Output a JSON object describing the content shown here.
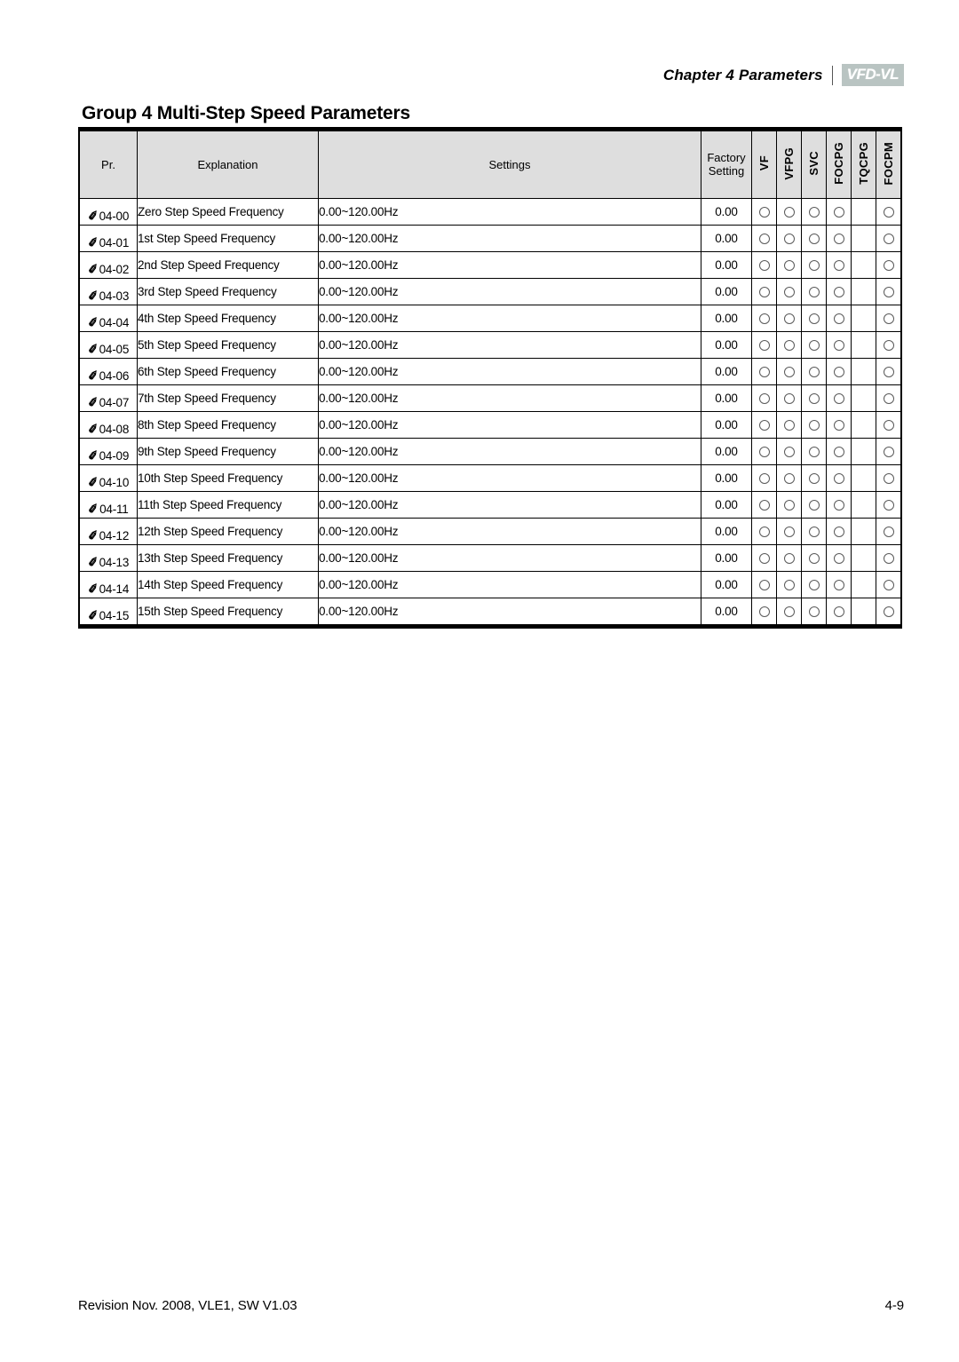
{
  "header": {
    "chapter": "Chapter 4 Parameters",
    "brand": "VFD-VL",
    "divider_icon": "vertical-bar-icon"
  },
  "title": "Group 4 Multi-Step Speed Parameters",
  "table": {
    "columns": {
      "pr": "Pr.",
      "explanation": "Explanation",
      "settings": "Settings",
      "factory_setting": "Factory Setting",
      "factory_setting_line1": "Factory",
      "factory_setting_line2": "Setting",
      "modes": [
        "VF",
        "VFPG",
        "SVC",
        "FOCPG",
        "TQCPG",
        "FOCPM"
      ]
    },
    "marker_icon": "pencil-icon",
    "marker_glyph": "✐",
    "circle_icon": "open-circle-icon",
    "rows": [
      {
        "pr": "04-00",
        "explanation": "Zero Step Speed Frequency",
        "settings": "0.00~120.00Hz",
        "factory": "0.00",
        "modes": [
          true,
          true,
          true,
          true,
          false,
          true
        ]
      },
      {
        "pr": "04-01",
        "explanation": "1st Step Speed Frequency",
        "settings": "0.00~120.00Hz",
        "factory": "0.00",
        "modes": [
          true,
          true,
          true,
          true,
          false,
          true
        ]
      },
      {
        "pr": "04-02",
        "explanation": "2nd Step Speed Frequency",
        "settings": "0.00~120.00Hz",
        "factory": "0.00",
        "modes": [
          true,
          true,
          true,
          true,
          false,
          true
        ]
      },
      {
        "pr": "04-03",
        "explanation": "3rd Step Speed Frequency",
        "settings": "0.00~120.00Hz",
        "factory": "0.00",
        "modes": [
          true,
          true,
          true,
          true,
          false,
          true
        ]
      },
      {
        "pr": "04-04",
        "explanation": "4th Step Speed Frequency",
        "settings": "0.00~120.00Hz",
        "factory": "0.00",
        "modes": [
          true,
          true,
          true,
          true,
          false,
          true
        ]
      },
      {
        "pr": "04-05",
        "explanation": "5th Step Speed Frequency",
        "settings": "0.00~120.00Hz",
        "factory": "0.00",
        "modes": [
          true,
          true,
          true,
          true,
          false,
          true
        ]
      },
      {
        "pr": "04-06",
        "explanation": "6th Step Speed Frequency",
        "settings": "0.00~120.00Hz",
        "factory": "0.00",
        "modes": [
          true,
          true,
          true,
          true,
          false,
          true
        ]
      },
      {
        "pr": "04-07",
        "explanation": "7th Step Speed Frequency",
        "settings": "0.00~120.00Hz",
        "factory": "0.00",
        "modes": [
          true,
          true,
          true,
          true,
          false,
          true
        ]
      },
      {
        "pr": "04-08",
        "explanation": "8th Step Speed Frequency",
        "settings": "0.00~120.00Hz",
        "factory": "0.00",
        "modes": [
          true,
          true,
          true,
          true,
          false,
          true
        ]
      },
      {
        "pr": "04-09",
        "explanation": "9th Step Speed Frequency",
        "settings": "0.00~120.00Hz",
        "factory": "0.00",
        "modes": [
          true,
          true,
          true,
          true,
          false,
          true
        ]
      },
      {
        "pr": "04-10",
        "explanation": "10th Step Speed Frequency",
        "settings": "0.00~120.00Hz",
        "factory": "0.00",
        "modes": [
          true,
          true,
          true,
          true,
          false,
          true
        ]
      },
      {
        "pr": "04-11",
        "explanation": "11th Step Speed Frequency",
        "settings": "0.00~120.00Hz",
        "factory": "0.00",
        "modes": [
          true,
          true,
          true,
          true,
          false,
          true
        ]
      },
      {
        "pr": "04-12",
        "explanation": "12th Step Speed Frequency",
        "settings": "0.00~120.00Hz",
        "factory": "0.00",
        "modes": [
          true,
          true,
          true,
          true,
          false,
          true
        ]
      },
      {
        "pr": "04-13",
        "explanation": "13th Step Speed Frequency",
        "settings": "0.00~120.00Hz",
        "factory": "0.00",
        "modes": [
          true,
          true,
          true,
          true,
          false,
          true
        ]
      },
      {
        "pr": "04-14",
        "explanation": "14th Step Speed Frequency",
        "settings": "0.00~120.00Hz",
        "factory": "0.00",
        "modes": [
          true,
          true,
          true,
          true,
          false,
          true
        ]
      },
      {
        "pr": "04-15",
        "explanation": "15th Step Speed Frequency",
        "settings": "0.00~120.00Hz",
        "factory": "0.00",
        "modes": [
          true,
          true,
          true,
          true,
          false,
          true
        ]
      }
    ]
  },
  "footer": {
    "revision": "Revision Nov. 2008, VLE1, SW V1.03",
    "page_number": "4-9"
  },
  "colors": {
    "header_fill": "#dedede",
    "brand_fill": "#b9c4c2",
    "border": "#000000",
    "circle_stroke": "#5a5a5a"
  }
}
